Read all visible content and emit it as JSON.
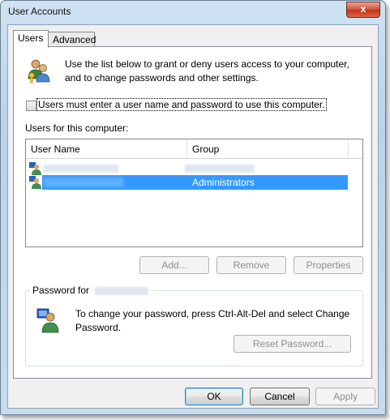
{
  "window": {
    "title": "User Accounts",
    "close_glyph": "x"
  },
  "tabs": [
    {
      "label": "Users",
      "active": true
    },
    {
      "label": "Advanced",
      "active": false
    }
  ],
  "users_tab": {
    "intro_text": "Use the list below to grant or deny users access to your computer, and to change passwords and other settings.",
    "intro_icon": "users-keys-icon",
    "must_enter_checkbox": {
      "label": "Users must enter a user name and password to use this computer.",
      "checked": false
    },
    "users_section_label": "Users for this computer:",
    "list": {
      "columns": [
        "User Name",
        "Group"
      ],
      "rows": [
        {
          "user_name": "",
          "group": "",
          "selected": false,
          "icon": "user-icon"
        },
        {
          "user_name": "",
          "group": "Administrators",
          "selected": true,
          "icon": "user-icon"
        }
      ]
    },
    "buttons": {
      "add": "Add...",
      "remove": "Remove",
      "properties": "Properties"
    },
    "password_group": {
      "title": "Password for",
      "icon": "user-password-icon",
      "text": "To change your password, press Ctrl-Alt-Del and select Change Password.",
      "reset_button": "Reset Password..."
    }
  },
  "footer": {
    "ok": "OK",
    "cancel": "Cancel",
    "apply": "Apply"
  },
  "colors": {
    "selection": "#3399ff",
    "titlebar": "#c4dbef",
    "close": "#c9432a"
  }
}
